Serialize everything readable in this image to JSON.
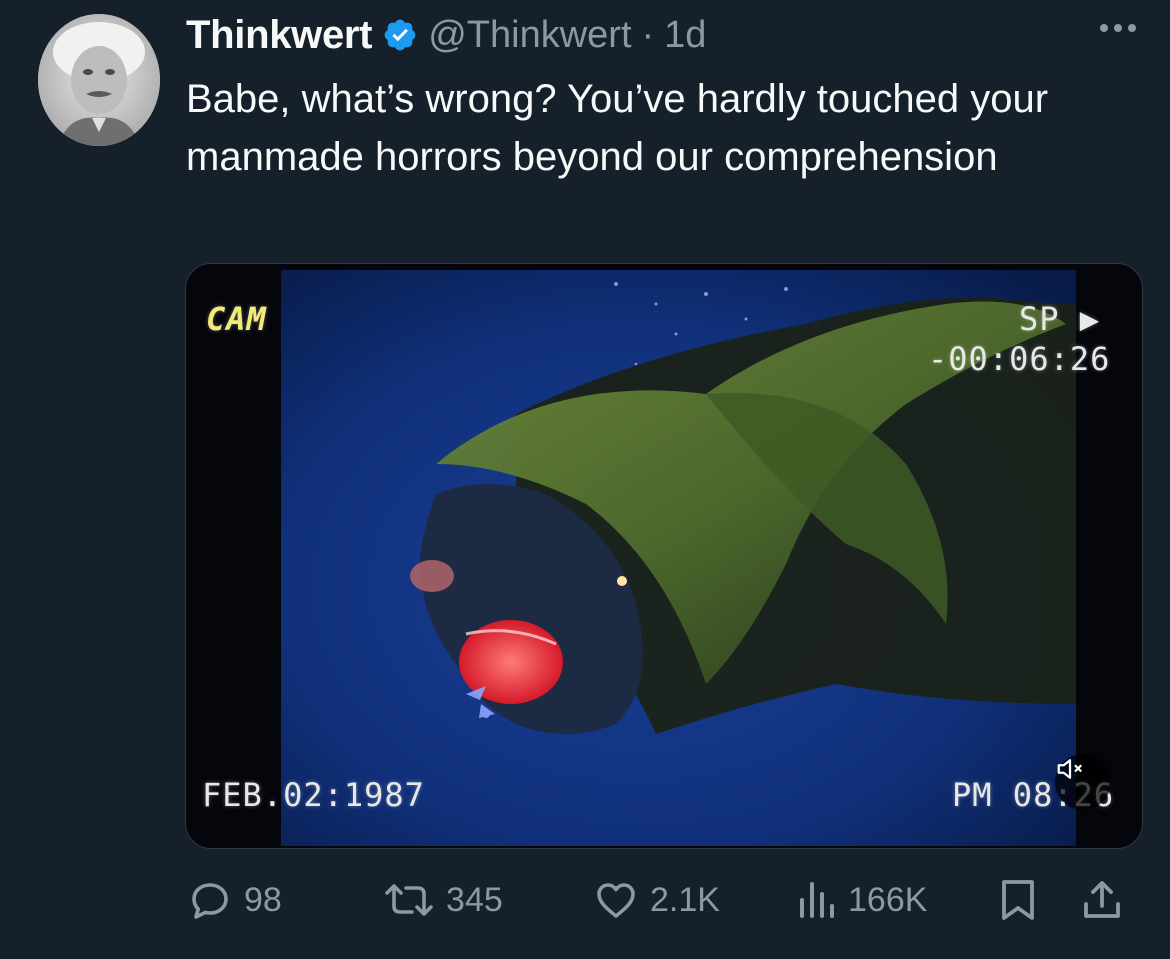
{
  "tweet": {
    "display_name": "Thinkwert",
    "handle": "@Thinkwert",
    "separator": "·",
    "time": "1d",
    "text": "Babe, what’s wrong? You’ve hardly touched your manmade horrors beyond our comprehension",
    "avatar_icon": "portrait-avatar",
    "verified_icon": "verified-badge-icon",
    "more_icon": "more-dots-icon"
  },
  "media": {
    "overlay_cam": "CAM",
    "overlay_sp": "SP ▶",
    "overlay_timer": "-00:06:26",
    "overlay_date": "FEB.02:1987",
    "overlay_time": "PM 08:26",
    "mute_icon": "speaker-muted-icon"
  },
  "actions": {
    "replies": "98",
    "retweets": "345",
    "likes": "2.1K",
    "views": "166K"
  },
  "colors": {
    "background": "#15202b",
    "text_primary": "#f7f9f9",
    "text_secondary": "#8b98a5",
    "verified": "#1d9bf0",
    "cam_label": "#f3eb78"
  }
}
